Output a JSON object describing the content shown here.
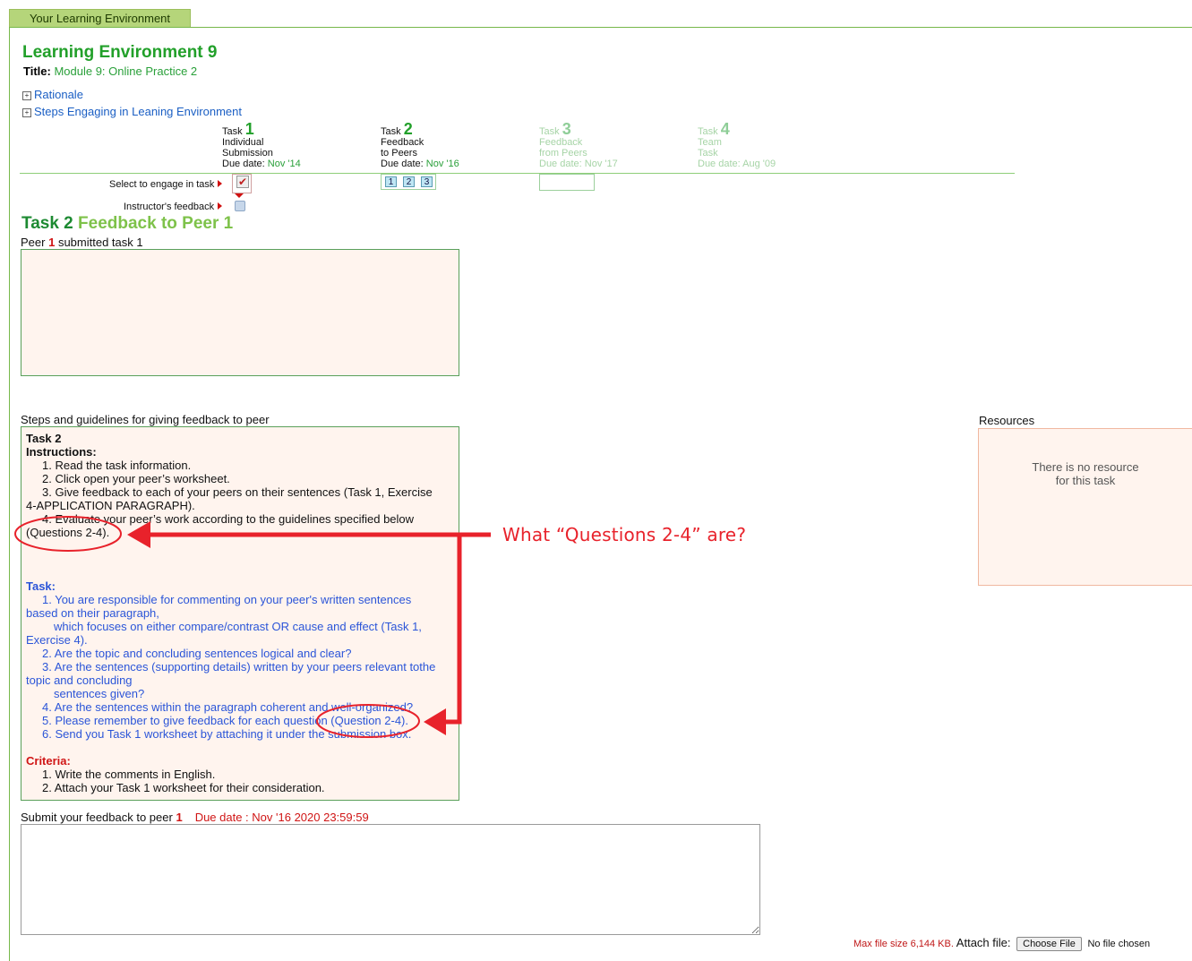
{
  "tab": {
    "label": "Your Learning Environment"
  },
  "env": {
    "heading": "Learning Environment 9",
    "title_label": "Title:",
    "title_value": "Module 9: Online Practice 2"
  },
  "expanders": [
    {
      "icon": "⊞",
      "label": "Rationale"
    },
    {
      "icon": "⊞",
      "label": "Steps Engaging in Leaning Environment"
    }
  ],
  "tasks": [
    {
      "prefix": "Task",
      "num": "1",
      "line1": "Individual",
      "line2": "Submission",
      "due_label": "Due date:",
      "due": "Nov '14",
      "state": "active"
    },
    {
      "prefix": "Task",
      "num": "2",
      "line1": "Feedback",
      "line2": "to Peers",
      "due_label": "Due date:",
      "due": "Nov '16",
      "state": "active"
    },
    {
      "prefix": "Task",
      "num": "3",
      "line1": "Feedback",
      "line2": "from Peers",
      "due_label": "Due date:",
      "due": "Nov '17",
      "state": "faded"
    },
    {
      "prefix": "Task",
      "num": "4",
      "line1": "Team",
      "line2": "Task",
      "due_label": "Due date:",
      "due": "Aug '09",
      "state": "faded"
    }
  ],
  "engage": {
    "select_label": "Select to engage in task",
    "instructor_label": "Instructor's feedback",
    "peer_buttons": [
      "1",
      "2",
      "3"
    ]
  },
  "feedback": {
    "heading_a": "Task 2",
    "heading_b": "Feedback to Peer 1",
    "peer_prefix": "Peer",
    "peer_num": "1",
    "peer_suffix": "submitted task 1"
  },
  "guidelines": {
    "label": "Steps and guidelines for giving feedback to peer",
    "task_heading": "Task 2",
    "instructions_heading": "Instructions:",
    "instructions": [
      "1. Read the task information.",
      "2. Click open your peer’s worksheet.",
      "3. Give feedback to each of your peers on their sentences (Task 1, Exercise",
      "4. Evaluate your peer’s work according to the guidelines specified below"
    ],
    "instructions_cont": [
      "4-APPLICATION PARAGRAPH).",
      "(Questions 2-4)."
    ],
    "task_label": "Task:",
    "task_lines": [
      "1. You are responsible for commenting on your peer's written sentences",
      "based on their paragraph,",
      "which focuses on either compare/contrast OR cause and effect (Task 1,",
      "Exercise 4).",
      "2. Are the topic and concluding sentences logical and clear?",
      "3. Are the sentences (supporting details) written by your peers relevant tothe",
      "topic and concluding",
      "sentences given?",
      "4. Are the sentences within the paragraph coherent and well-organized?",
      "5. Please remember to give feedback for each question (Question 2-4).",
      "6. Send you Task 1 worksheet by attaching it under the submission box."
    ],
    "criteria_label": "Criteria:",
    "criteria": [
      "1. Write the comments in English.",
      "2. Attach your Task 1 worksheet for their consideration."
    ]
  },
  "resources": {
    "label": "Resources",
    "empty_line1": "There is no resource",
    "empty_line2": "for this task"
  },
  "submit": {
    "label_prefix": "Submit your feedback to peer",
    "peer_num": "1",
    "due": "Due date : Nov '16 2020 23:59:59"
  },
  "attach": {
    "max": "Max file size 6,144 KB.",
    "label": "Attach file:",
    "button": "Choose File",
    "status": "No file chosen"
  },
  "annotation": {
    "text": "What “Questions 2-4” are?",
    "color": "#e8222b"
  }
}
